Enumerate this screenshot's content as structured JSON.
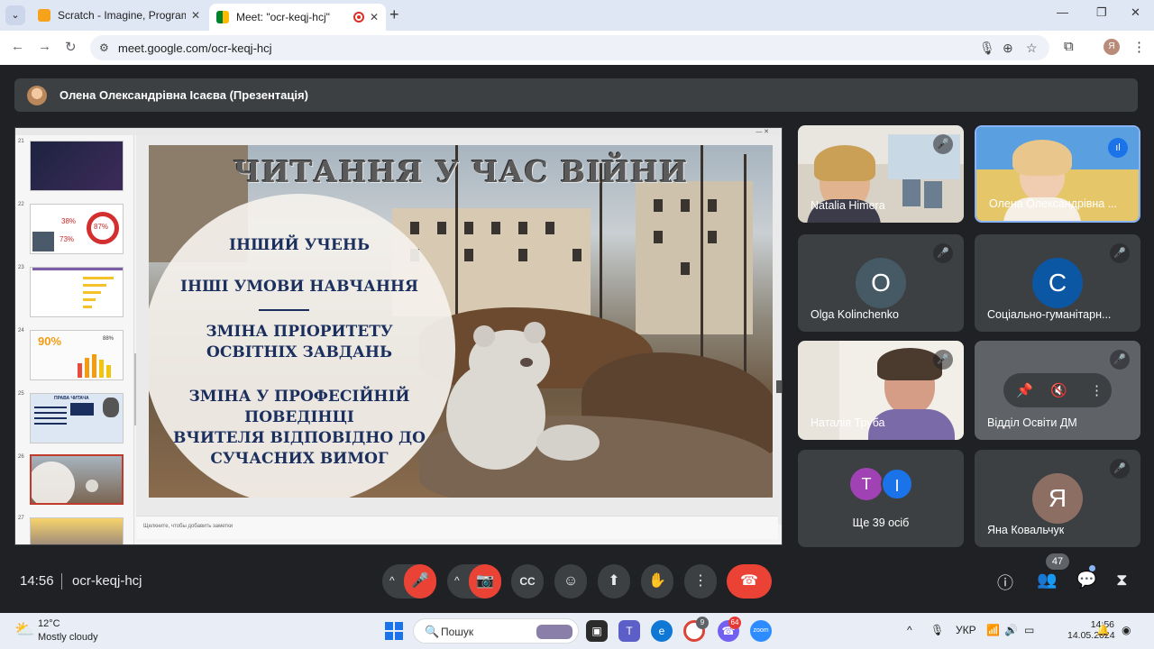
{
  "browser": {
    "tabs": [
      {
        "title": "Scratch - Imagine, Program, Sha",
        "active": false
      },
      {
        "title": "Meet: \"ocr-keqj-hcj\"",
        "active": true
      }
    ],
    "url": "meet.google.com/ocr-keqj-hcj",
    "profile_initial": "Я"
  },
  "meeting": {
    "presenter_banner": "Олена Олександрівна Ісаєва (Презентація)",
    "time": "14:56",
    "code": "ocr-keqj-hcj",
    "participants_count": "47"
  },
  "slide": {
    "title": "ЧИТАННЯ У ЧАС ВІЙНИ",
    "line1": "ІНШИЙ УЧЕНЬ",
    "line2": "ІНШІ УМОВИ НАВЧАННЯ",
    "line3a": "ЗМІНА ПРІОРИТЕТУ",
    "line3b": "ОСВІТНІХ ЗАВДАНЬ",
    "line4a": "ЗМІНА У ПРОФЕСІЙНІЙ",
    "line4b": "ПОВЕДІНЦІ",
    "line4c": "ВЧИТЕЛЯ ВІДПОВІДНО ДО",
    "line4d": "СУЧАСНИХ ВИМОГ",
    "notes_placeholder": "Щелкните, чтобы добавить заметки",
    "thumb_numbers": [
      "21",
      "22",
      "23",
      "24",
      "25",
      "26",
      "27"
    ],
    "thumb_texts": {
      "t22a": "38%",
      "t22b": "87%",
      "t22c": "73%",
      "t24": "90%",
      "t24b": "88%",
      "t25": "ПРАВА ЧИТАЧА"
    }
  },
  "participants": [
    {
      "name": "Natalia Himera",
      "muted": true,
      "video": true
    },
    {
      "name": "Олена Олександрівна ...",
      "muted": false,
      "video": true,
      "speaking": true
    },
    {
      "name": "Olga Kolinchenko",
      "muted": true,
      "initial": "O",
      "color": "#455a64"
    },
    {
      "name": "Соціально-гуманітарн...",
      "muted": true,
      "initial": "C",
      "color": "#0b57a4"
    },
    {
      "name": "Наталія Труба",
      "muted": true,
      "video": true
    },
    {
      "name": "Відділ Освіти ДМ",
      "muted": true
    },
    {
      "name": "Ще 39 осіб",
      "initials": [
        "T",
        "I"
      ],
      "colors": [
        "#a142b4",
        "#1a73e8"
      ]
    },
    {
      "name": "Яна Ковальчук",
      "muted": true,
      "initial": "Я",
      "color": "#8d6e63"
    }
  ],
  "taskbar": {
    "temp": "12°C",
    "weather": "Mostly cloudy",
    "search_placeholder": "Пошук",
    "lang": "УКР",
    "time": "14:56",
    "date": "14.05.2024",
    "badge_chrome": "9",
    "badge_viber": "64"
  },
  "colors": {
    "end_call": "#ea4335",
    "accent": "#8ab4f8",
    "meet_bg": "#202124"
  }
}
